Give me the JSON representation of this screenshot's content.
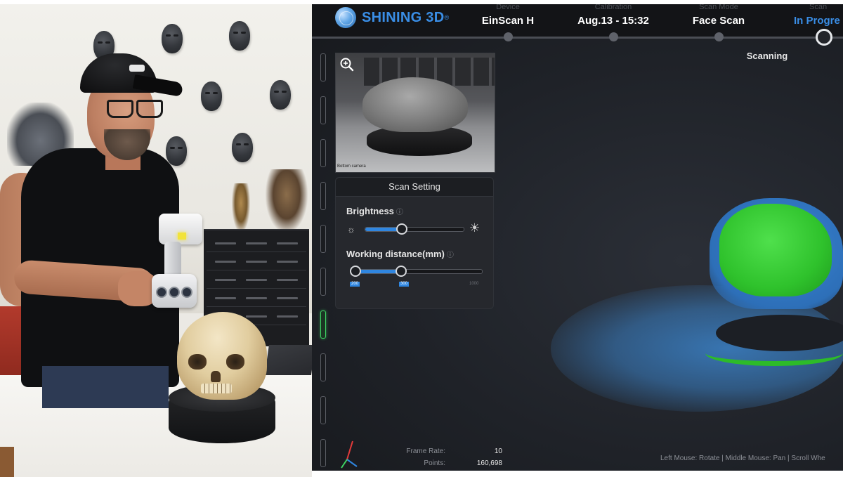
{
  "brand": {
    "name": "SHINING 3D",
    "reg": "®"
  },
  "steps": [
    {
      "label": "Device",
      "value": "EinScan H"
    },
    {
      "label": "Calibration",
      "value": "Aug.13 - 15:32"
    },
    {
      "label": "Scan Mode",
      "value": "Face Scan"
    },
    {
      "label": "Scan",
      "value": "In Progre"
    }
  ],
  "status": "Scanning",
  "camera": {
    "caption": "Bottom camera"
  },
  "scan_setting": {
    "title": "Scan Setting",
    "brightness": {
      "label": "Brightness",
      "level": 0.37
    },
    "working_distance": {
      "label": "Working distance(mm)",
      "min_tag": "200",
      "value_tag": "300",
      "max": "1000",
      "low_fraction": 0.0,
      "high_fraction": 0.38
    }
  },
  "stats": {
    "frame_rate_label": "Frame Rate:",
    "frame_rate": "10",
    "points_label": "Points:",
    "points": "160,698"
  },
  "hint": "Left Mouse: Rotate | Middle Mouse: Pan | Scroll Whe",
  "colors": {
    "accent": "#2f86e0",
    "brand": "#3a8ee6",
    "scan_green": "#2fc22c",
    "cloud_blue": "#3b82c8"
  }
}
